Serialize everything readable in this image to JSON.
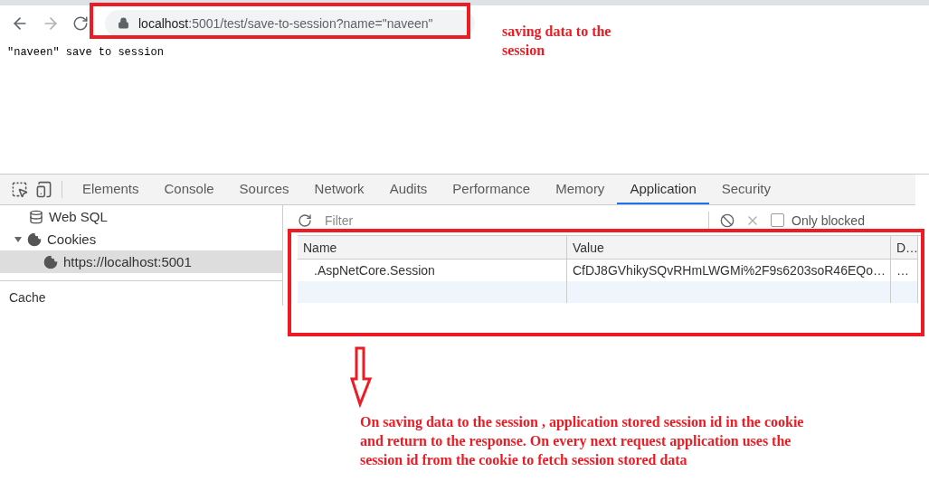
{
  "browser": {
    "url_host": "localhost",
    "url_rest": ":5001/test/save-to-session?name=\"naveen\""
  },
  "page": {
    "text": "\"naveen\" save to session"
  },
  "devtools": {
    "tabs": [
      {
        "label": "Elements",
        "selected": false
      },
      {
        "label": "Console",
        "selected": false
      },
      {
        "label": "Sources",
        "selected": false
      },
      {
        "label": "Network",
        "selected": false
      },
      {
        "label": "Audits",
        "selected": false
      },
      {
        "label": "Performance",
        "selected": false
      },
      {
        "label": "Memory",
        "selected": false
      },
      {
        "label": "Application",
        "selected": true
      },
      {
        "label": "Security",
        "selected": false
      }
    ],
    "sidebar": {
      "items": [
        {
          "label": "Web SQL",
          "kind": "database",
          "selected": false
        },
        {
          "label": "Cookies",
          "kind": "cookies",
          "selected": false,
          "expanded": true,
          "children": [
            {
              "label": "https://localhost:5001",
              "kind": "cookie",
              "selected": true
            }
          ]
        }
      ],
      "section": "Cache"
    },
    "filter": {
      "placeholder": "Filter"
    },
    "only_blocked": {
      "label": "Only blocked",
      "checked": false
    },
    "table": {
      "columns": [
        "Name",
        "Value",
        "D…"
      ],
      "rows": [
        {
          "cells": [
            ".AspNetCore.Session",
            "CfDJ8GVhikySQvRHmLWGMi%2F9s6203soR46EQo…",
            "…"
          ]
        }
      ]
    }
  },
  "annotations": {
    "url_note": "saving data to the session",
    "cookie_note": "On saving data to the session , application stored session id in the cookie and return to the response. On every next request application uses the session id from the cookie to fetch session stored data"
  }
}
